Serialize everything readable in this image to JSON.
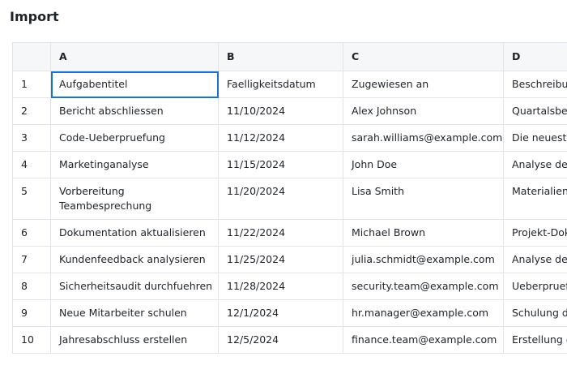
{
  "page": {
    "title": "Import"
  },
  "sheet": {
    "columns": [
      "A",
      "B",
      "C",
      "D"
    ],
    "rows": [
      {
        "num": "1",
        "a": "Aufgabentitel",
        "b": "Faelligkeitsdatum",
        "c": "Zugewiesen an",
        "d": "Beschreibung"
      },
      {
        "num": "2",
        "a": "Bericht abschliessen",
        "b": "11/10/2024",
        "c": "Alex Johnson",
        "d": "Quartalsbericht"
      },
      {
        "num": "3",
        "a": "Code-Ueberpruefung",
        "b": "11/12/2024",
        "c": "sarah.williams@example.com",
        "d": "Die neuesten"
      },
      {
        "num": "4",
        "a": "Marketinganalyse",
        "b": "11/15/2024",
        "c": "John Doe",
        "d": "Analyse der"
      },
      {
        "num": "5",
        "a": "Vorbereitung Teambesprechung",
        "b": "11/20/2024",
        "c": "Lisa Smith",
        "d": "Materialien"
      },
      {
        "num": "6",
        "a": "Dokumentation aktualisieren",
        "b": "11/22/2024",
        "c": "Michael Brown",
        "d": "Projekt-Dok"
      },
      {
        "num": "7",
        "a": "Kundenfeedback analysieren",
        "b": "11/25/2024",
        "c": "julia.schmidt@example.com",
        "d": "Analyse der Produkten."
      },
      {
        "num": "8",
        "a": "Sicherheitsaudit durchfuehren",
        "b": "11/28/2024",
        "c": "security.team@example.com",
        "d": "Ueberpruefung Sicherheits"
      },
      {
        "num": "9",
        "a": "Neue Mitarbeiter schulen",
        "b": "12/1/2024",
        "c": "hr.manager@example.com",
        "d": "Schulung d"
      },
      {
        "num": "10",
        "a": "Jahresabschluss erstellen",
        "b": "12/5/2024",
        "c": "finance.team@example.com",
        "d": "Erstellung d"
      }
    ]
  }
}
